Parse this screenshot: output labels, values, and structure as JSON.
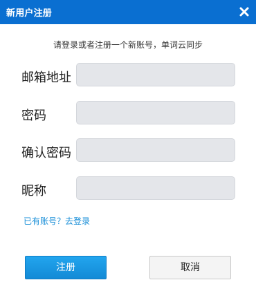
{
  "titlebar": {
    "title": "新用户注册"
  },
  "subtitle": "请登录或者注册一个新账号，单词云同步",
  "form": {
    "email_label": "邮箱地址",
    "password_label": "密码",
    "confirm_label": "确认密码",
    "nickname_label": "昵称"
  },
  "login_link": "已有账号？去登录",
  "buttons": {
    "register": "注册",
    "cancel": "取消"
  },
  "colors": {
    "titlebar": "#0a6fd1",
    "primary_button": "#1a9be3",
    "link": "#1a8fd8",
    "input_bg": "#e4e6ea"
  },
  "icons": {
    "close": "close-icon"
  }
}
